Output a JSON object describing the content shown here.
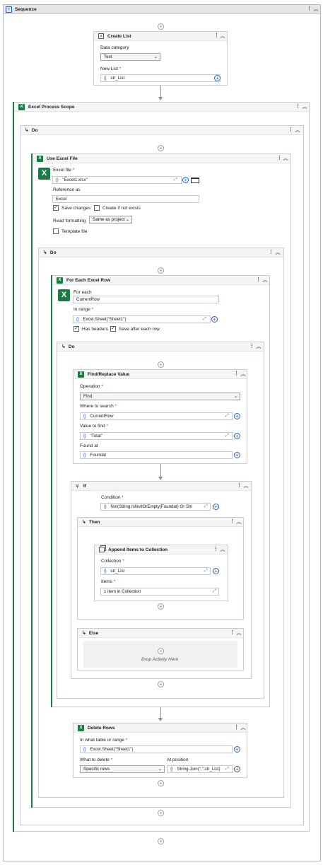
{
  "sequence": {
    "title": "Sequence"
  },
  "create_list": {
    "title": "Create List",
    "data_category_label": "Data category",
    "data_category_value": "Text",
    "new_list_label": "New List",
    "new_list_value": "str_List"
  },
  "excel_scope": {
    "title": "Excel Process Scope",
    "do_label": "Do"
  },
  "use_excel": {
    "title": "Use Excel File",
    "file_label": "Excel file",
    "file_value": "\"Excel1.xlsx\"",
    "ref_label": "Reference as",
    "ref_value": "Excel",
    "save_changes": "Save changes",
    "create_if_not_exists": "Create if not exists",
    "read_formatting_label": "Read formatting",
    "read_formatting_value": "Same as project",
    "template_file": "Template file",
    "do_label": "Do"
  },
  "for_each": {
    "title": "For Each Excel Row",
    "for_each_label": "For each",
    "for_each_value": "CurrentRow",
    "in_range_label": "In range",
    "in_range_value": "Excel.Sheet(\"Sheet1\")",
    "has_headers": "Has headers",
    "save_after": "Save after each row",
    "do_label": "Do"
  },
  "find_replace": {
    "title": "Find/Replace Value",
    "operation_label": "Operation",
    "operation_value": "Find",
    "where_label": "Where to search",
    "where_value": "CurrentRow",
    "value_label": "Value to find",
    "value_value": "\"Total\"",
    "found_label": "Found at",
    "found_value": "Foundat"
  },
  "if_block": {
    "title": "If",
    "condition_label": "Condition",
    "condition_value": "Not(String.IsNullOrEmpty(Foundat) Or Stri",
    "then_label": "Then",
    "else_label": "Else",
    "drop_text": "Drop Activity Here"
  },
  "append": {
    "title": "Append Items to Collection",
    "collection_label": "Collection",
    "collection_value": "str_List",
    "items_label": "Items",
    "items_value": "1 item in Collection"
  },
  "delete_rows": {
    "title": "Delete Rows",
    "range_label": "In what table or range",
    "range_value": "Excel.Sheet(\"Sheet1\")",
    "what_label": "What to delete",
    "what_value": "Specific rows",
    "position_label": "At position",
    "position_value": "String.Join(\",\",str_List)"
  },
  "symbols": {
    "braces": "{}",
    "required": "*",
    "check": "✓",
    "kebab": "⋮",
    "collapse": "︽",
    "do_arrow": "↳",
    "plus": "+",
    "expand": "⤢",
    "chevron": "⌄"
  }
}
